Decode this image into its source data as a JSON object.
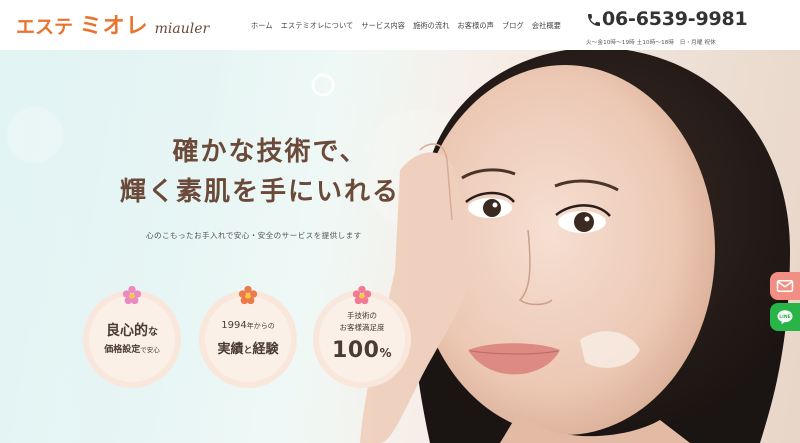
{
  "header": {
    "logo_prefix": "エステ",
    "logo_main": "ミオレ",
    "logo_sub": "miauler",
    "nav": [
      "ホーム",
      "エステミオレについて",
      "サービス内容",
      "施術の流れ",
      "お客様の声",
      "ブログ",
      "会社概要"
    ],
    "phone": "06-6539-9981",
    "hours": "火～金10時～19時 土10時～18時　日・月曜 祝休"
  },
  "hero": {
    "headline_line1": "確かな技術で、",
    "headline_line2": "輝く素肌を手にいれる",
    "tagline": "心のこもったお手入れで安心・安全のサービスを提供します"
  },
  "badges": [
    {
      "line1_big": "良心的",
      "line1_small": "な",
      "line2_big": "価格設定",
      "line2_small": "で安心"
    },
    {
      "line1_big": "1994",
      "line1_small": "年からの",
      "line2_big": "実績",
      "line2_mid": "と",
      "line2_big2": "経験"
    },
    {
      "line1": "手技術の",
      "line2": "お客様満足度",
      "value": "100",
      "unit": "%"
    }
  ],
  "side_buttons": {
    "mail_icon": "mail-icon",
    "line_icon": "line-icon",
    "line_label": "LINE"
  },
  "colors": {
    "brand_orange": "#e9742f",
    "headline_brown": "#6b4a3a",
    "badge_peach": "#f9e7db",
    "line_green": "#28b446",
    "mail_pink": "#f28f84"
  }
}
